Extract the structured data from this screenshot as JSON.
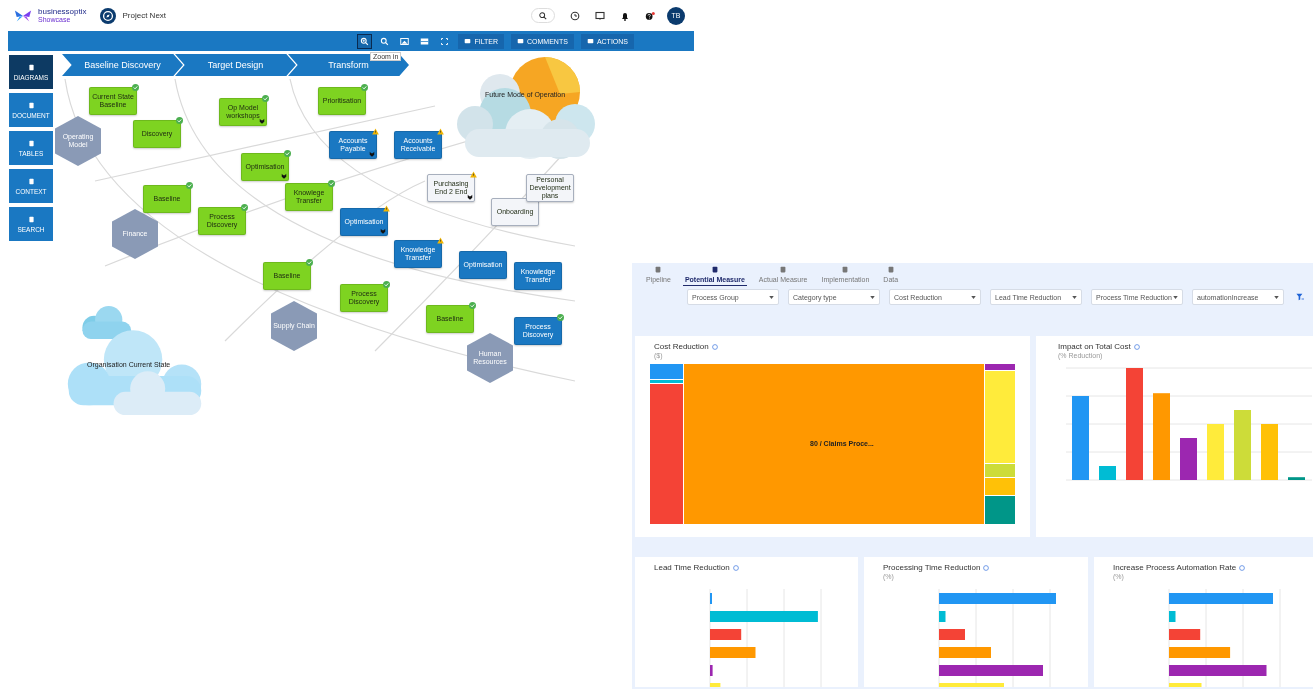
{
  "header": {
    "brand": "businessoptix",
    "brand_sub": "Showcase",
    "project": "Project Next",
    "avatar": "TB"
  },
  "toolbar": {
    "buttons": [
      "FILTER",
      "COMMENTS",
      "ACTIONS"
    ],
    "tooltip": "Zoom in"
  },
  "sidebar": {
    "items": [
      {
        "label": "DIAGRAMS",
        "selected": true
      },
      {
        "label": "DOCUMENT",
        "selected": false
      },
      {
        "label": "TABLES",
        "selected": false
      },
      {
        "label": "CONTEXT",
        "selected": false
      },
      {
        "label": "SEARCH",
        "selected": false
      }
    ]
  },
  "diagram": {
    "phases": [
      "Baseline Discovery",
      "Target Design",
      "Transform"
    ],
    "clouds": [
      "Future Mode of Operation",
      "Organisation Current State"
    ],
    "areas": [
      "Operating Model",
      "Finance",
      "Supply Chain",
      "Human Resources"
    ],
    "nodes": [
      {
        "label": "Current State Baseline",
        "color": "#7ed321",
        "done": true,
        "warning": false,
        "flagged": false
      },
      {
        "label": "Discovery",
        "color": "#7ed321",
        "done": true,
        "warning": false,
        "flagged": false
      },
      {
        "label": "Op Model workshops",
        "color": "#7ed321",
        "done": true,
        "warning": false,
        "flagged": true
      },
      {
        "label": "Optimisation",
        "color": "#7ed321",
        "done": true,
        "warning": false,
        "flagged": true
      },
      {
        "label": "Baseline",
        "color": "#7ed321",
        "done": true,
        "warning": false,
        "flagged": false
      },
      {
        "label": "Process Discovery",
        "color": "#7ed321",
        "done": true,
        "warning": false,
        "flagged": false
      },
      {
        "label": "Knowlege Transfer",
        "color": "#7ed321",
        "done": true,
        "warning": false,
        "flagged": false
      },
      {
        "label": "Prioritisation",
        "color": "#7ed321",
        "done": true,
        "warning": false,
        "flagged": false
      },
      {
        "label": "Baseline",
        "color": "#7ed321",
        "done": true,
        "warning": false,
        "flagged": false
      },
      {
        "label": "Process Discovery",
        "color": "#7ed321",
        "done": true,
        "warning": false,
        "flagged": false
      },
      {
        "label": "Baseline",
        "color": "#7ed321",
        "done": true,
        "warning": false,
        "flagged": false
      },
      {
        "label": "Accounts Payable",
        "color": "#1a78c2",
        "done": false,
        "warning": true,
        "flagged": true
      },
      {
        "label": "Accounts Receivable",
        "color": "#1a78c2",
        "done": false,
        "warning": true,
        "flagged": false
      },
      {
        "label": "Optimisation",
        "color": "#1a78c2",
        "done": false,
        "warning": true,
        "flagged": true
      },
      {
        "label": "Knowledge Transfer",
        "color": "#1a78c2",
        "done": false,
        "warning": true,
        "flagged": false
      },
      {
        "label": "Optimisation",
        "color": "#1a78c2",
        "done": false,
        "warning": false,
        "flagged": false
      },
      {
        "label": "Knowledge Transfer",
        "color": "#1a78c2",
        "done": false,
        "warning": false,
        "flagged": false
      },
      {
        "label": "Process Discovery",
        "color": "#1a78c2",
        "done": true,
        "warning": false,
        "flagged": false
      },
      {
        "label": "Purchasing End 2 End",
        "color": "#f3f5f9",
        "done": false,
        "warning": true,
        "flagged": true
      },
      {
        "label": "Onboarding",
        "color": "#f3f5f9",
        "done": false,
        "warning": false,
        "flagged": false
      },
      {
        "label": "Personal Development plans",
        "color": "#f3f5f9",
        "done": false,
        "warning": false,
        "flagged": false
      }
    ]
  },
  "dashboard": {
    "tabs": [
      {
        "label": "Pipeline",
        "selected": false
      },
      {
        "label": "Potential Measure",
        "selected": true
      },
      {
        "label": "Actual Measure",
        "selected": false
      },
      {
        "label": "Implementation",
        "selected": false
      },
      {
        "label": "Data",
        "selected": false
      }
    ],
    "filters": [
      "Process Group",
      "Category type",
      "Cost Reduction",
      "Lead Time Reduction",
      "Process Time Reduction",
      "automationIncrease"
    ],
    "cards": [
      {
        "kind": "treemap",
        "title": "Cost Reduction",
        "subtitle": "($)",
        "label": "80 / Claims Proce..."
      },
      {
        "kind": "columns",
        "title": "Impact on Total Cost",
        "subtitle": "(% Reduction)"
      },
      {
        "kind": "hbars",
        "title": "Lead Time Reduction"
      },
      {
        "kind": "hbars",
        "title": "Processing Time Reduction",
        "subtitle": "(%)"
      },
      {
        "kind": "hbars",
        "title": "Increase Process Automation Rate",
        "subtitle": "(%)"
      }
    ]
  }
}
